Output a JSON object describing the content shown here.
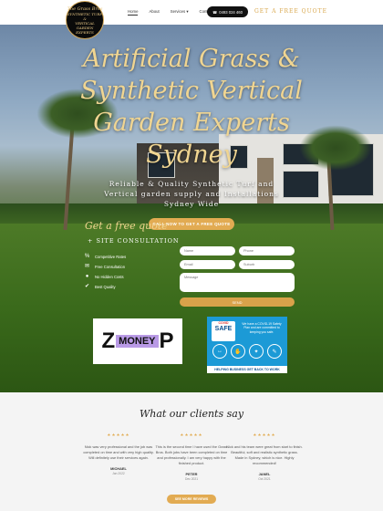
{
  "logo": {
    "line1": "The Grass Bros",
    "line2": "SYNTHETIC TURF &",
    "line3": "VERTICAL GARDEN",
    "line4": "EXPERTS"
  },
  "nav": {
    "items": [
      "Home",
      "About",
      "Services ▾",
      "Contact"
    ]
  },
  "header": {
    "phone": "0493 024 460",
    "quote": "GET A FREE QUOTE"
  },
  "hero": {
    "title_l1": "Artificial Grass &",
    "title_l2": "Synthetic Vertical",
    "title_l3": "Garden Experts",
    "title_l4": "Sydney",
    "subtitle": "Reliable & Quality Synthetic Turf and Vertical garden supply and Installations Sydney Wide",
    "cta": "CALL NOW TO GET A FREE QUOTE"
  },
  "form": {
    "title": "Get a free quote",
    "subtitle": "+ SITE CONSULTATION",
    "features": [
      "Competitive Rates",
      "Free Consultation",
      "No Hidden Costs",
      "Best Quality"
    ],
    "name_placeholder": "Name",
    "phone_placeholder": "Phone",
    "email_placeholder": "Email",
    "suburb_placeholder": "Suburb",
    "message_placeholder": "Message",
    "send": "SEND"
  },
  "partners": {
    "zmoney": {
      "z": "Z",
      "m": "MONEY",
      "p": "P"
    },
    "covid": {
      "badge_top": "COVID",
      "badge_main": "SAFE",
      "text": "We have a COVID-19 Safety Plan and are committed to keeping you safe.",
      "footer": "HELPING BUSINESS GET BACK TO WORK"
    }
  },
  "reviews": {
    "title": "What our clients say",
    "items": [
      {
        "stars": "★★★★★",
        "text": "Nick was very professional and the job was completed on time and with very high quality. Will definitely use their services again.",
        "name": "MICHAEL",
        "date": "Jan 2022"
      },
      {
        "stars": "★★★★★",
        "text": "This is the second time I have used the Grass Bros. Both jobs have been completed on time and professionally. I am very happy with the finished product.",
        "name": "PETER",
        "date": "Dec 2021"
      },
      {
        "stars": "★★★★★",
        "text": "Nick and his team were great from start to finish. Beautiful, soft and realistic synthetic grass. Made in Sydney, which is nice. Highly recommended!",
        "name": "JANEL",
        "date": "Oct 2021"
      }
    ],
    "button": "SEE MORE REVIEWS"
  },
  "colors": {
    "accent": "#e2ab52",
    "hero_text": "#f0d591",
    "dark": "#111111"
  }
}
